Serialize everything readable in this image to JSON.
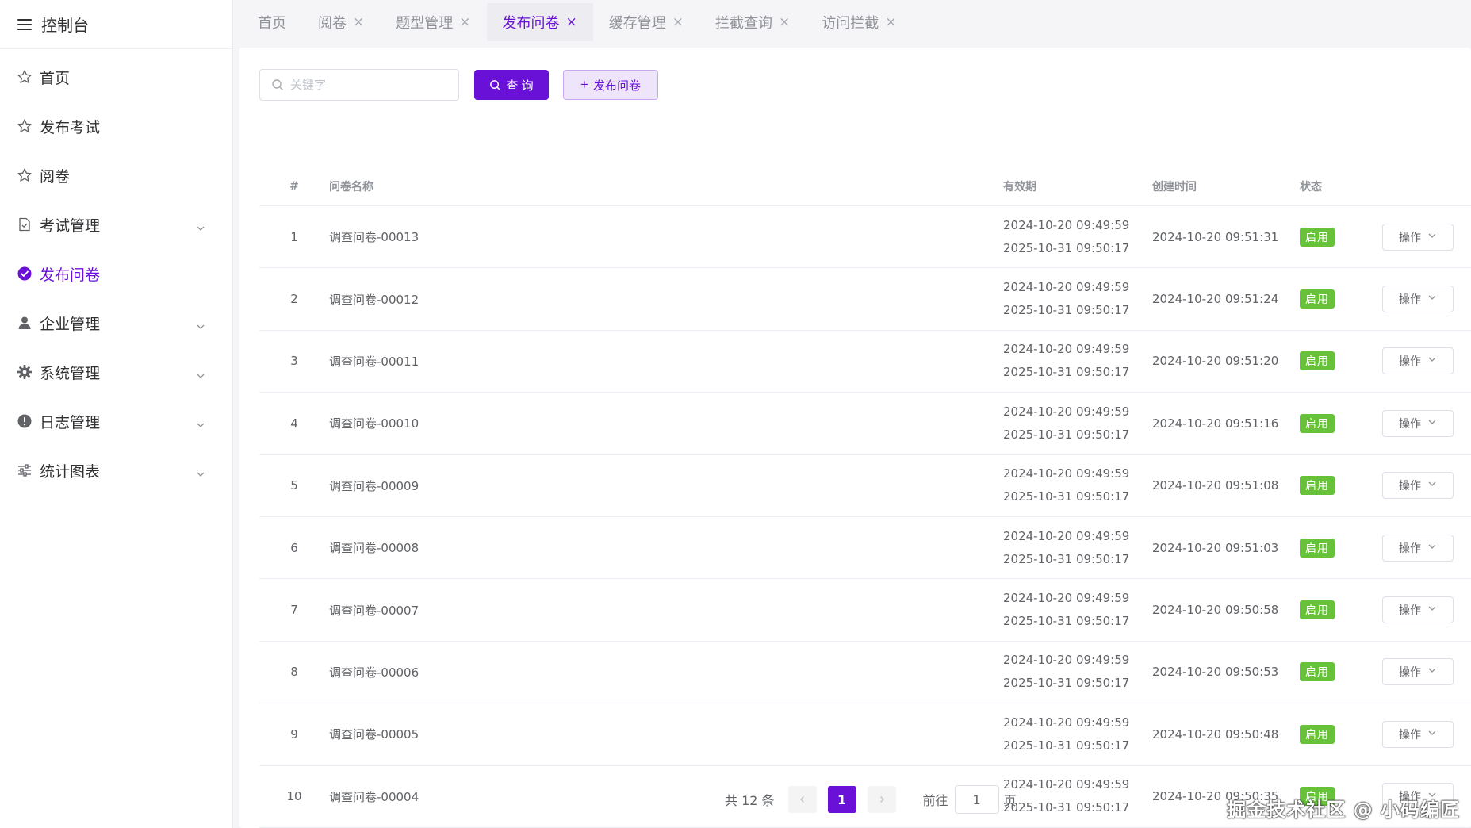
{
  "sidebar": {
    "title": "控制台",
    "items": [
      {
        "label": "首页",
        "icon": "star-icon",
        "active": false,
        "expandable": false
      },
      {
        "label": "发布考试",
        "icon": "star-icon",
        "active": false,
        "expandable": false
      },
      {
        "label": "阅卷",
        "icon": "star-icon",
        "active": false,
        "expandable": false
      },
      {
        "label": "考试管理",
        "icon": "document-check-icon",
        "active": false,
        "expandable": true
      },
      {
        "label": "发布问卷",
        "icon": "check-circle-icon",
        "active": true,
        "expandable": false
      },
      {
        "label": "企业管理",
        "icon": "user-icon",
        "active": false,
        "expandable": true
      },
      {
        "label": "系统管理",
        "icon": "gear-icon",
        "active": false,
        "expandable": true
      },
      {
        "label": "日志管理",
        "icon": "warning-circle-icon",
        "active": false,
        "expandable": true
      },
      {
        "label": "统计图表",
        "icon": "sliders-icon",
        "active": false,
        "expandable": true
      }
    ]
  },
  "tabs": [
    {
      "label": "首页",
      "closable": false,
      "active": false
    },
    {
      "label": "阅卷",
      "closable": true,
      "active": false
    },
    {
      "label": "题型管理",
      "closable": true,
      "active": false
    },
    {
      "label": "发布问卷",
      "closable": true,
      "active": true
    },
    {
      "label": "缓存管理",
      "closable": true,
      "active": false
    },
    {
      "label": "拦截查询",
      "closable": true,
      "active": false
    },
    {
      "label": "访问拦截",
      "closable": true,
      "active": false
    }
  ],
  "toolbar": {
    "search_placeholder": "关键字",
    "search_value": "",
    "query_label": "查 询",
    "publish_label": "发布问卷"
  },
  "table": {
    "headers": {
      "index": "#",
      "name": "问卷名称",
      "valid": "有效期",
      "created": "创建时间",
      "status": "状态"
    },
    "rows": [
      {
        "index": "1",
        "name": "调查问卷-00013",
        "valid_start": "2024-10-20 09:49:59",
        "valid_end": "2025-10-31 09:50:17",
        "created": "2024-10-20 09:51:31",
        "status": "启用",
        "action": "操作"
      },
      {
        "index": "2",
        "name": "调查问卷-00012",
        "valid_start": "2024-10-20 09:49:59",
        "valid_end": "2025-10-31 09:50:17",
        "created": "2024-10-20 09:51:24",
        "status": "启用",
        "action": "操作"
      },
      {
        "index": "3",
        "name": "调查问卷-00011",
        "valid_start": "2024-10-20 09:49:59",
        "valid_end": "2025-10-31 09:50:17",
        "created": "2024-10-20 09:51:20",
        "status": "启用",
        "action": "操作"
      },
      {
        "index": "4",
        "name": "调查问卷-00010",
        "valid_start": "2024-10-20 09:49:59",
        "valid_end": "2025-10-31 09:50:17",
        "created": "2024-10-20 09:51:16",
        "status": "启用",
        "action": "操作"
      },
      {
        "index": "5",
        "name": "调查问卷-00009",
        "valid_start": "2024-10-20 09:49:59",
        "valid_end": "2025-10-31 09:50:17",
        "created": "2024-10-20 09:51:08",
        "status": "启用",
        "action": "操作"
      },
      {
        "index": "6",
        "name": "调查问卷-00008",
        "valid_start": "2024-10-20 09:49:59",
        "valid_end": "2025-10-31 09:50:17",
        "created": "2024-10-20 09:51:03",
        "status": "启用",
        "action": "操作"
      },
      {
        "index": "7",
        "name": "调查问卷-00007",
        "valid_start": "2024-10-20 09:49:59",
        "valid_end": "2025-10-31 09:50:17",
        "created": "2024-10-20 09:50:58",
        "status": "启用",
        "action": "操作"
      },
      {
        "index": "8",
        "name": "调查问卷-00006",
        "valid_start": "2024-10-20 09:49:59",
        "valid_end": "2025-10-31 09:50:17",
        "created": "2024-10-20 09:50:53",
        "status": "启用",
        "action": "操作"
      },
      {
        "index": "9",
        "name": "调查问卷-00005",
        "valid_start": "2024-10-20 09:49:59",
        "valid_end": "2025-10-31 09:50:17",
        "created": "2024-10-20 09:50:48",
        "status": "启用",
        "action": "操作"
      },
      {
        "index": "10",
        "name": "调查问卷-00004",
        "valid_start": "2024-10-20 09:49:59",
        "valid_end": "2025-10-31 09:50:17",
        "created": "2024-10-20 09:50:35",
        "status": "启用",
        "action": "操作"
      }
    ]
  },
  "pagination": {
    "total": "共 12 条",
    "current_page": "1",
    "goto_label": "前往",
    "goto_value": "1",
    "page_unit": "页"
  },
  "watermark": "掘金技术社区 @ 小码编匠",
  "colors": {
    "accent": "#6a11d8",
    "success": "#67c23a",
    "border": "#ebeef5"
  }
}
